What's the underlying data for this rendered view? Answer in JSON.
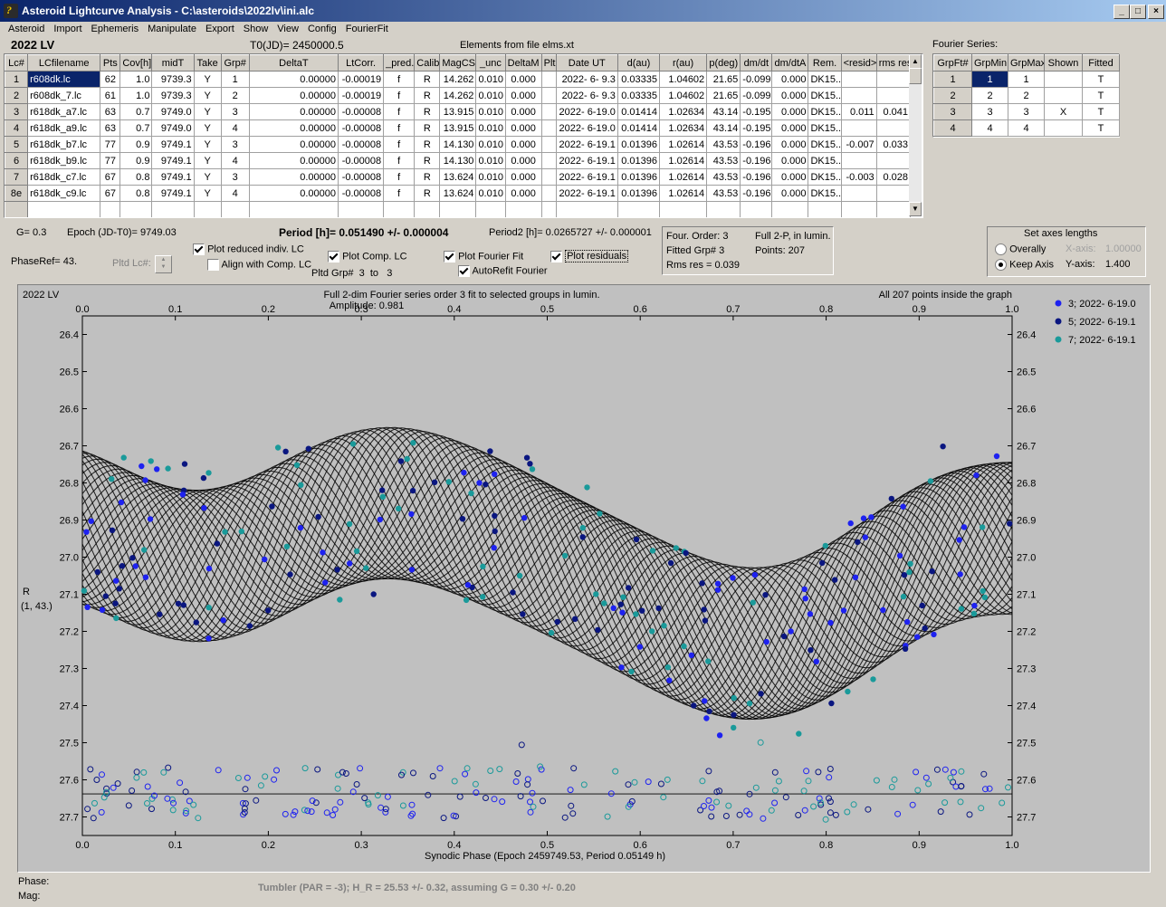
{
  "window": {
    "title": "Asteroid Lightcurve Analysis - C:\\asteroids\\2022lv\\ini.alc",
    "minimize": "_",
    "maximize": "□",
    "close": "×"
  },
  "menu": [
    "Asteroid",
    "Import",
    "Ephemeris",
    "Manipulate",
    "Export",
    "Show",
    "View",
    "Config",
    "FourierFit"
  ],
  "header": {
    "object": "2022 LV",
    "t0": "T0(JD)= 2450000.5",
    "elements": "Elements from file elms.xt"
  },
  "lc_table": {
    "columns": [
      "Lc#",
      "LCfilename",
      "Pts",
      "Cov[h]",
      "midT",
      "Take",
      "Grp#",
      "DeltaT",
      "LtCorr.",
      "_pred.",
      "Calib.",
      "MagCS",
      "_unc",
      "DeltaM",
      "Plt",
      "Date UT",
      "d(au)",
      "r(au)",
      "p(deg)",
      "dm/dt",
      "dm/dtA",
      "Rem.",
      "<resid>",
      "rms res"
    ],
    "rows": [
      [
        "1",
        "r608dk.lc",
        "62",
        "1.0",
        "9739.3",
        "Y",
        "1",
        "0.00000",
        "-0.00019",
        "f",
        "R",
        "14.262",
        "0.010",
        "0.000",
        "",
        "2022- 6- 9.3",
        "0.03335",
        "1.04602",
        "21.65",
        "-0.099",
        "0.000",
        "DK15..",
        "",
        ""
      ],
      [
        "2",
        "r608dk_7.lc",
        "61",
        "1.0",
        "9739.3",
        "Y",
        "2",
        "0.00000",
        "-0.00019",
        "f",
        "R",
        "14.262",
        "0.010",
        "0.000",
        "",
        "2022- 6- 9.3",
        "0.03335",
        "1.04602",
        "21.65",
        "-0.099",
        "0.000",
        "DK15..",
        "",
        ""
      ],
      [
        "3",
        "r618dk_a7.lc",
        "63",
        "0.7",
        "9749.0",
        "Y",
        "3",
        "0.00000",
        "-0.00008",
        "f",
        "R",
        "13.915",
        "0.010",
        "0.000",
        "",
        "2022- 6-19.0",
        "0.01414",
        "1.02634",
        "43.14",
        "-0.195",
        "0.000",
        "DK15..",
        "0.011",
        "0.041"
      ],
      [
        "4",
        "r618dk_a9.lc",
        "63",
        "0.7",
        "9749.0",
        "Y",
        "4",
        "0.00000",
        "-0.00008",
        "f",
        "R",
        "13.915",
        "0.010",
        "0.000",
        "",
        "2022- 6-19.0",
        "0.01414",
        "1.02634",
        "43.14",
        "-0.195",
        "0.000",
        "DK15..",
        "",
        ""
      ],
      [
        "5",
        "r618dk_b7.lc",
        "77",
        "0.9",
        "9749.1",
        "Y",
        "3",
        "0.00000",
        "-0.00008",
        "f",
        "R",
        "14.130",
        "0.010",
        "0.000",
        "",
        "2022- 6-19.1",
        "0.01396",
        "1.02614",
        "43.53",
        "-0.196",
        "0.000",
        "DK15..",
        "-0.007",
        "0.033"
      ],
      [
        "6",
        "r618dk_b9.lc",
        "77",
        "0.9",
        "9749.1",
        "Y",
        "4",
        "0.00000",
        "-0.00008",
        "f",
        "R",
        "14.130",
        "0.010",
        "0.000",
        "",
        "2022- 6-19.1",
        "0.01396",
        "1.02614",
        "43.53",
        "-0.196",
        "0.000",
        "DK15..",
        "",
        ""
      ],
      [
        "7",
        "r618dk_c7.lc",
        "67",
        "0.8",
        "9749.1",
        "Y",
        "3",
        "0.00000",
        "-0.00008",
        "f",
        "R",
        "13.624",
        "0.010",
        "0.000",
        "",
        "2022- 6-19.1",
        "0.01396",
        "1.02614",
        "43.53",
        "-0.196",
        "0.000",
        "DK15..",
        "-0.003",
        "0.028"
      ],
      [
        "8e",
        "r618dk_c9.lc",
        "67",
        "0.8",
        "9749.1",
        "Y",
        "4",
        "0.00000",
        "-0.00008",
        "f",
        "R",
        "13.624",
        "0.010",
        "0.000",
        "",
        "2022- 6-19.1",
        "0.01396",
        "1.02614",
        "43.53",
        "-0.196",
        "0.000",
        "DK15..",
        "",
        ""
      ]
    ]
  },
  "fourier_series": {
    "title": "Fourier Series:",
    "columns": [
      "GrpFt#",
      "GrpMin",
      "GrpMax",
      "Shown",
      "Fitted"
    ],
    "rows": [
      [
        "1",
        "1",
        "1",
        "",
        "T"
      ],
      [
        "2",
        "2",
        "2",
        "",
        "T"
      ],
      [
        "3",
        "3",
        "3",
        "X",
        "T"
      ],
      [
        "4",
        "4",
        "4",
        "",
        "T"
      ]
    ]
  },
  "info": {
    "g": "G= 0.3",
    "epoch": "Epoch (JD-T0)= 9749.03",
    "period": "Period [h]= 0.051490 +/- 0.000004",
    "period2": "Period2 [h]= 0.0265727 +/- 0.000001",
    "phase_ref": "PhaseRef= 43.",
    "pltd_lc": "Pltd Lc#:",
    "plot_reduced": "Plot reduced indiv. LC",
    "align_comp": "Align with Comp. LC",
    "plot_comp": "Plot Comp. LC",
    "pltd_grp": "Pltd Grp#",
    "grp_from": "3",
    "grp_to_label": "to",
    "grp_to": "3",
    "plot_fourier": "Plot Fourier Fit",
    "autorefit": "AutoRefit Fourier",
    "plot_residuals": "Plot residuals",
    "four_order": "Four. Order:  3",
    "fitted_grp": "Fitted Grp# 3",
    "rms_res": "Rms res     = 0.039",
    "full2p": "Full 2-P, in lumin.",
    "points": "Points: 207",
    "axes_title": "Set axes lengths",
    "overally": "Overally",
    "keep_axis": "Keep Axis",
    "xaxis_label": "X-axis:",
    "xaxis_val": "1.00000",
    "yaxis_label": "Y-axis:",
    "yaxis_val": "1.400"
  },
  "chart_data": {
    "type": "scatter",
    "title": "2022 LV",
    "subtitle": "Full 2-dim Fourier series order 3 fit to selected groups in lumin.",
    "amplitude": "Amplitude: 0.981",
    "note": "All 207 points inside the graph",
    "xlabel": "Synodic Phase (Epoch 2459749.53, Period 0.05149 h)",
    "ylabel": "R",
    "ylabel2": "(1, 43.)",
    "xlim": [
      0,
      1
    ],
    "ylim": [
      27.75,
      26.35
    ],
    "xticks": [
      "0.0",
      "0.1",
      "0.2",
      "0.3",
      "0.4",
      "0.5",
      "0.6",
      "0.7",
      "0.8",
      "0.9",
      "1.0"
    ],
    "yticks": [
      "26.4",
      "26.5",
      "26.6",
      "26.7",
      "26.8",
      "26.9",
      "27.0",
      "27.1",
      "27.2",
      "27.3",
      "27.4",
      "27.5",
      "27.6",
      "27.7"
    ],
    "residual_baseline": 27.638,
    "series": [
      {
        "name": "3; 2022- 6-19.0",
        "color": "#1e22f0"
      },
      {
        "name": "5; 2022- 6-19.1",
        "color": "#0a1680"
      },
      {
        "name": "7; 2022- 6-19.1",
        "color": "#1a9a9a"
      }
    ]
  },
  "footer": {
    "phase": "Phase:",
    "mag": "Mag:",
    "tumbler": "Tumbler (PAR = -3); H_R = 25.53 +/- 0.32, assuming G = 0.30 +/- 0.20"
  }
}
